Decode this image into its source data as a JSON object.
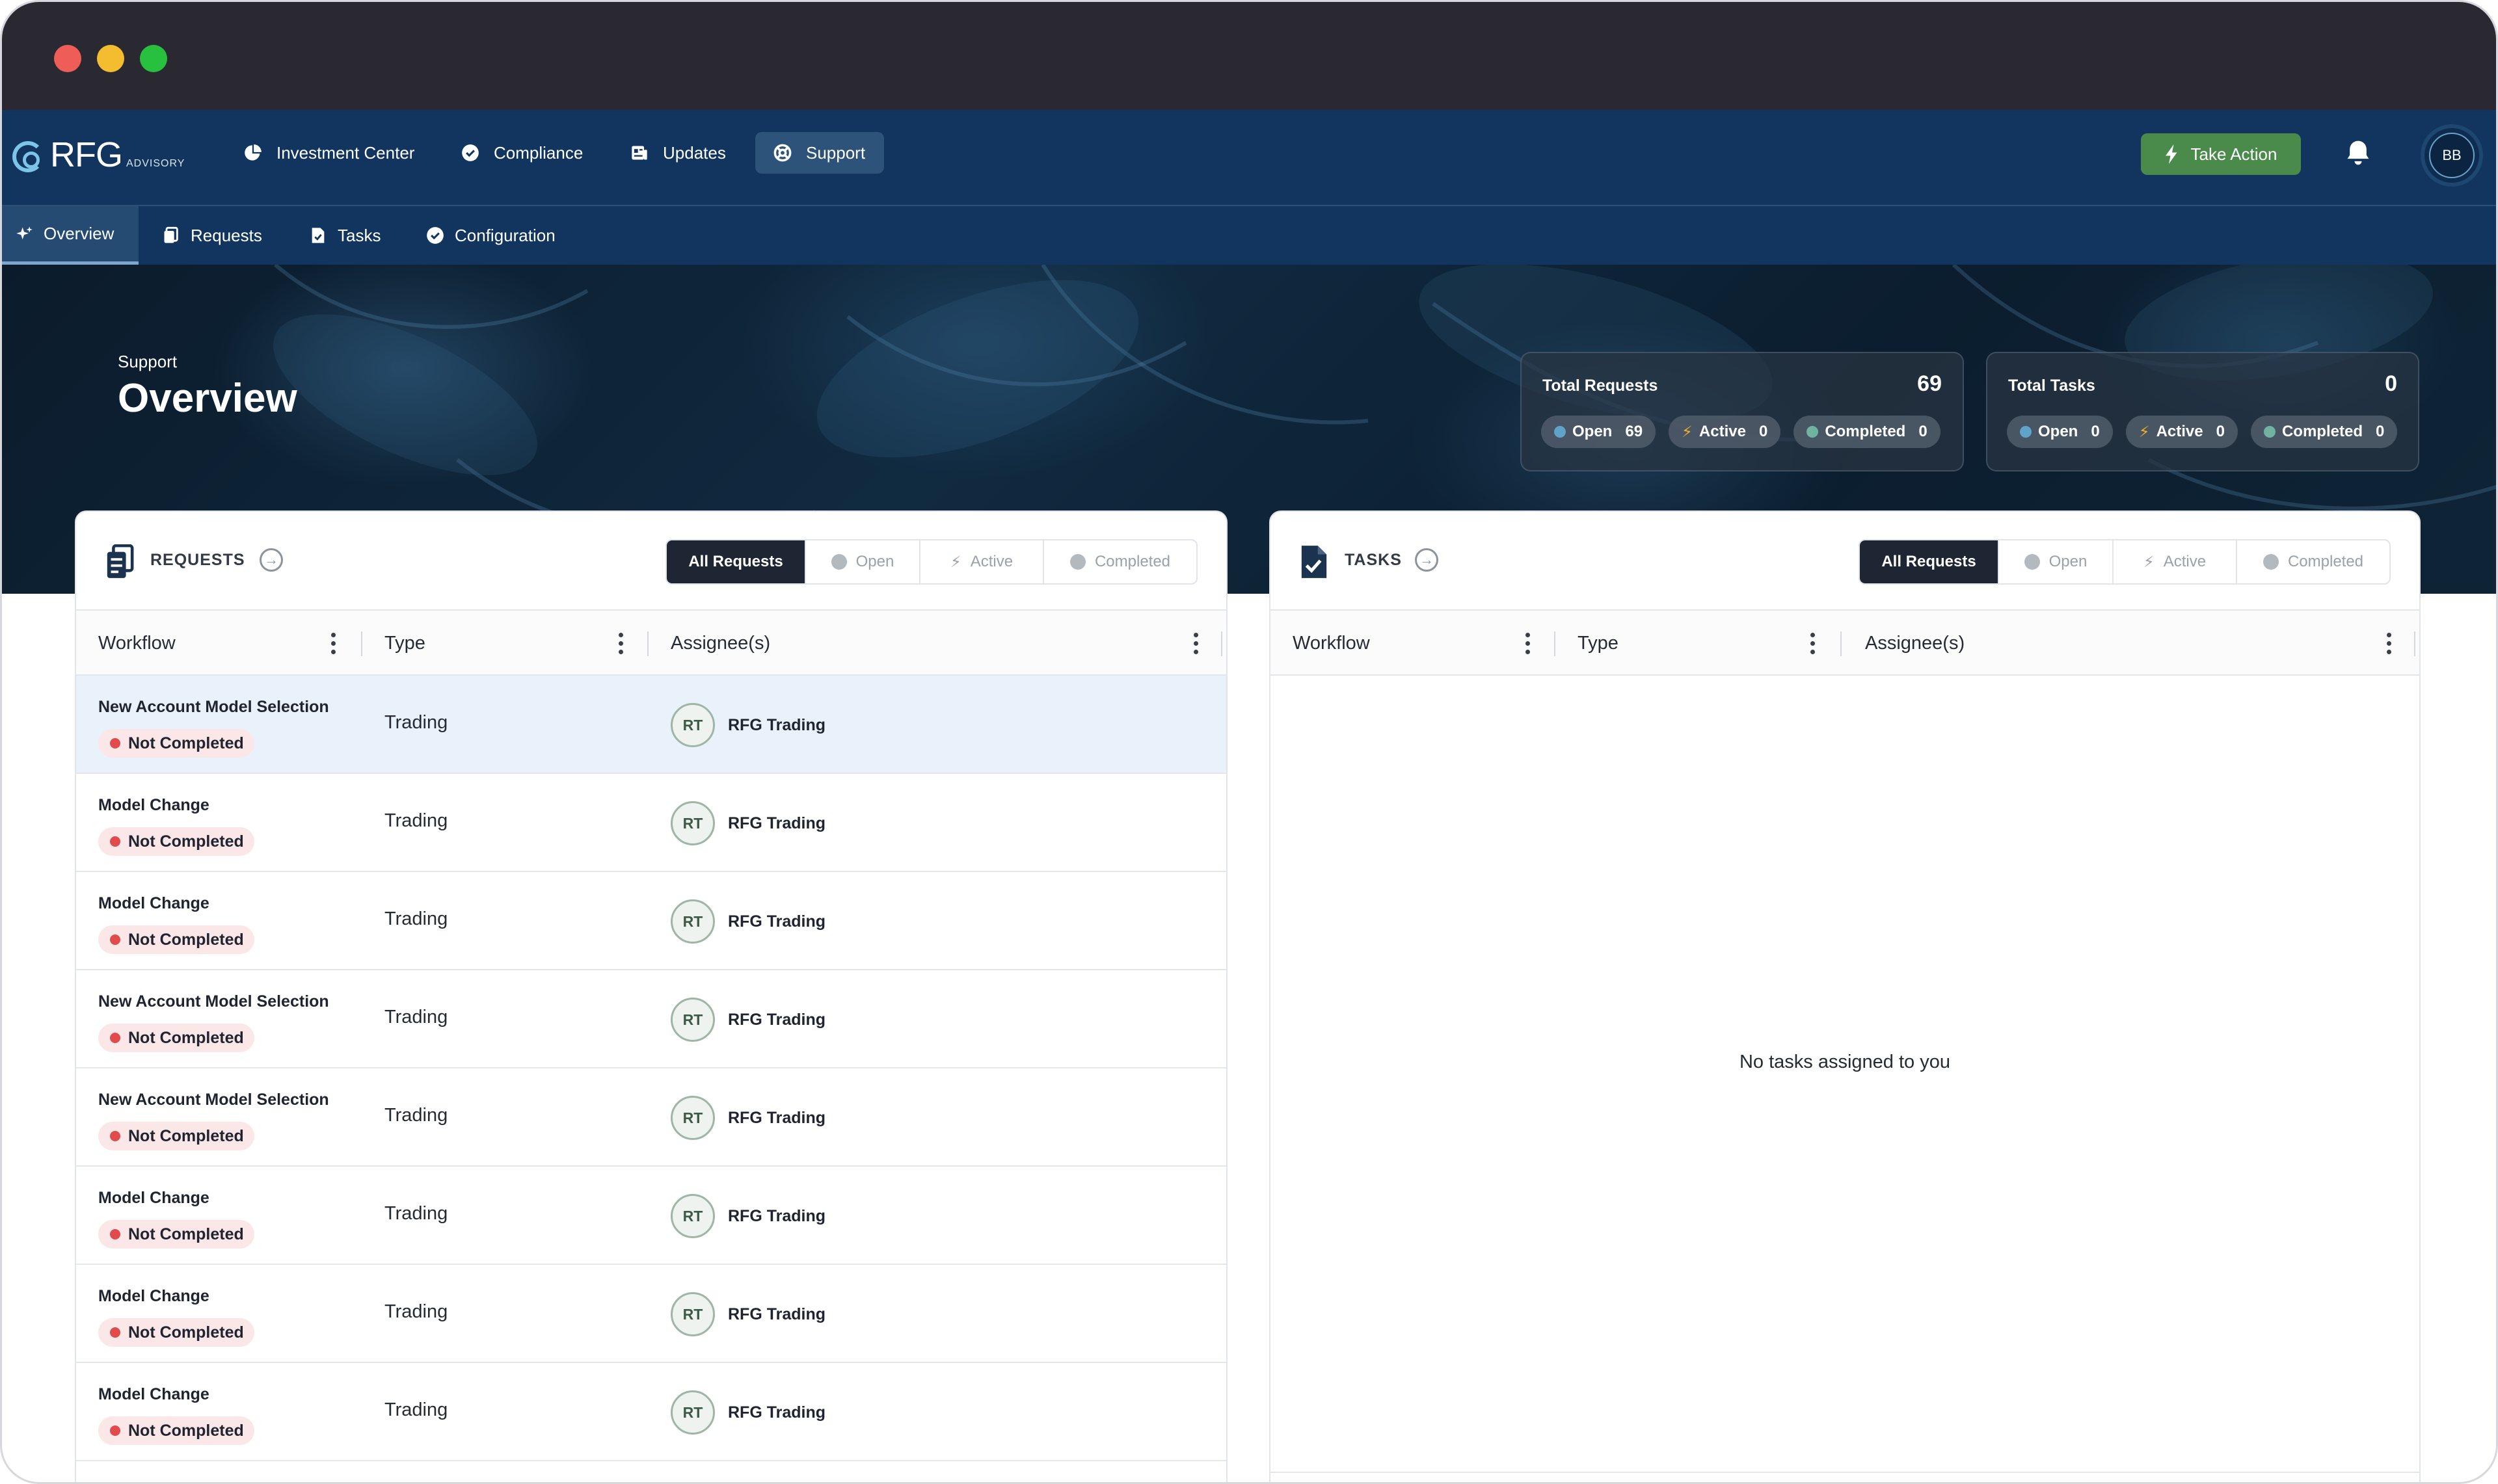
{
  "brand": {
    "name": "RFG",
    "sub": "ADVISORY"
  },
  "topnav": {
    "items": [
      {
        "label": "Investment Center",
        "icon": "pie-chart-icon"
      },
      {
        "label": "Compliance",
        "icon": "check-circle-icon"
      },
      {
        "label": "Updates",
        "icon": "newspaper-icon"
      },
      {
        "label": "Support",
        "icon": "lifebuoy-icon",
        "active": true
      }
    ],
    "take_action": "Take Action",
    "avatar_initials": "BB"
  },
  "subnav": {
    "items": [
      {
        "label": "Overview",
        "icon": "sparkle-icon",
        "active": true
      },
      {
        "label": "Requests",
        "icon": "documents-icon"
      },
      {
        "label": "Tasks",
        "icon": "file-check-icon"
      },
      {
        "label": "Configuration",
        "icon": "check-circle-icon"
      }
    ]
  },
  "hero": {
    "eyebrow": "Support",
    "title": "Overview",
    "requests_card": {
      "title": "Total Requests",
      "total": "69",
      "pills": [
        {
          "label": "Open",
          "value": "69"
        },
        {
          "label": "Active",
          "value": "0"
        },
        {
          "label": "Completed",
          "value": "0"
        }
      ]
    },
    "tasks_card": {
      "title": "Total Tasks",
      "total": "0",
      "pills": [
        {
          "label": "Open",
          "value": "0"
        },
        {
          "label": "Active",
          "value": "0"
        },
        {
          "label": "Completed",
          "value": "0"
        }
      ]
    }
  },
  "requests_panel": {
    "title": "REQUESTS",
    "filters": [
      "All Requests",
      "Open",
      "Active",
      "Completed"
    ],
    "columns": [
      "Workflow",
      "Type",
      "Assignee(s)"
    ],
    "rows": [
      {
        "workflow": "New Account Model Selection",
        "status": "Not Completed",
        "type": "Trading",
        "initials": "RT",
        "assignee": "RFG Trading"
      },
      {
        "workflow": "Model Change",
        "status": "Not Completed",
        "type": "Trading",
        "initials": "RT",
        "assignee": "RFG Trading"
      },
      {
        "workflow": "Model Change",
        "status": "Not Completed",
        "type": "Trading",
        "initials": "RT",
        "assignee": "RFG Trading"
      },
      {
        "workflow": "New Account Model Selection",
        "status": "Not Completed",
        "type": "Trading",
        "initials": "RT",
        "assignee": "RFG Trading"
      },
      {
        "workflow": "New Account Model Selection",
        "status": "Not Completed",
        "type": "Trading",
        "initials": "RT",
        "assignee": "RFG Trading"
      },
      {
        "workflow": "Model Change",
        "status": "Not Completed",
        "type": "Trading",
        "initials": "RT",
        "assignee": "RFG Trading"
      },
      {
        "workflow": "Model Change",
        "status": "Not Completed",
        "type": "Trading",
        "initials": "RT",
        "assignee": "RFG Trading"
      },
      {
        "workflow": "Model Change",
        "status": "Not Completed",
        "type": "Trading",
        "initials": "RT",
        "assignee": "RFG Trading"
      }
    ]
  },
  "tasks_panel": {
    "title": "TASKS",
    "filters": [
      "All Requests",
      "Open",
      "Active",
      "Completed"
    ],
    "columns": [
      "Workflow",
      "Type",
      "Assignee(s)"
    ],
    "empty_text": "No tasks assigned to you"
  },
  "colors": {
    "nav_bg": "#11355e",
    "accent_green": "#4a8a4a",
    "status_red": "#e14b4b",
    "open_blue": "#5fa4c8",
    "active_yellow": "#f0b02a"
  }
}
